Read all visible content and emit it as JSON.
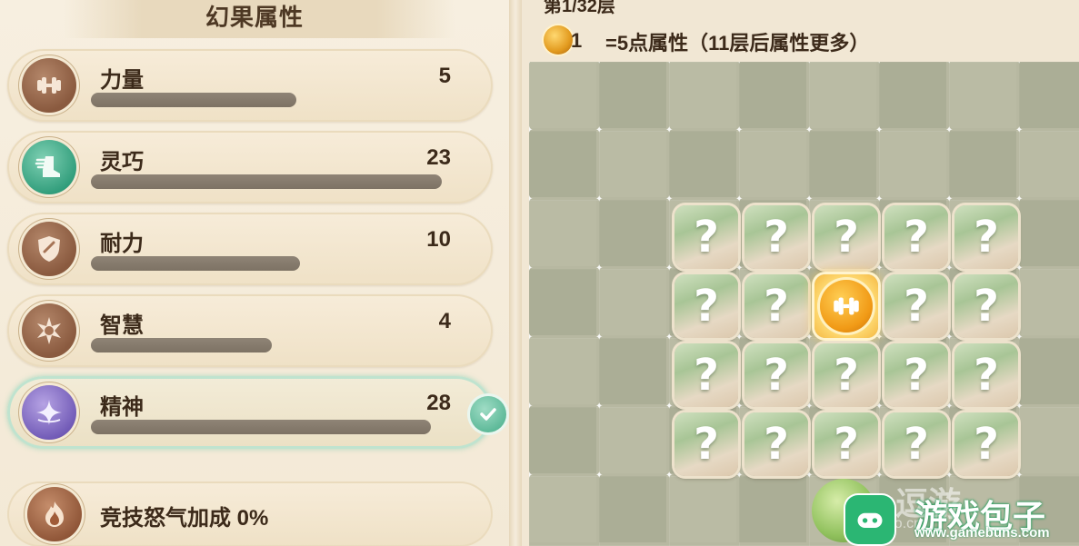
{
  "panel": {
    "title": "幻果属性"
  },
  "stats": [
    {
      "label": "力量",
      "value": "5",
      "bar_fraction": 0.58,
      "icon": "dumbbell-icon",
      "tone": "brown"
    },
    {
      "label": "灵巧",
      "value": "23",
      "bar_fraction": 0.99,
      "icon": "winged-boot-icon",
      "tone": "green"
    },
    {
      "label": "耐力",
      "value": "10",
      "bar_fraction": 0.59,
      "icon": "shield-icon",
      "tone": "brown"
    },
    {
      "label": "智慧",
      "value": "4",
      "bar_fraction": 0.51,
      "icon": "star-burst-icon",
      "tone": "brown"
    },
    {
      "label": "精神",
      "value": "28",
      "bar_fraction": 0.96,
      "icon": "spirit-star-icon",
      "tone": "purple",
      "selected": true
    }
  ],
  "rage": {
    "label": "竞技怒气加成 0%",
    "icon": "flame-icon"
  },
  "floor": {
    "text": "第1/32层"
  },
  "reward": {
    "count": "1",
    "text": "=5点属性（11层后属性更多）",
    "icon": "fruit-coin-icon"
  },
  "board": {
    "rows": [
      [
        "?",
        "?",
        "?",
        "?",
        "?"
      ],
      [
        "?",
        "?",
        "dumbbell",
        "?",
        "?"
      ],
      [
        "?",
        "?",
        "?",
        "?",
        "?"
      ],
      [
        "?",
        "?",
        "?",
        "?",
        "?"
      ]
    ],
    "unknown_symbol": "?"
  },
  "watermark": {
    "ghost": "逗游",
    "ghost_sub": "doyo.cn",
    "title": "游戏包子",
    "url": "www.gamebuns.com"
  },
  "colors": {
    "bar_fill": "#7d7264",
    "selected_glow": "#bfe3cf",
    "check": "#5bb897",
    "board": "#b7b8a1",
    "revealed_tile": "#ffdf7a"
  }
}
